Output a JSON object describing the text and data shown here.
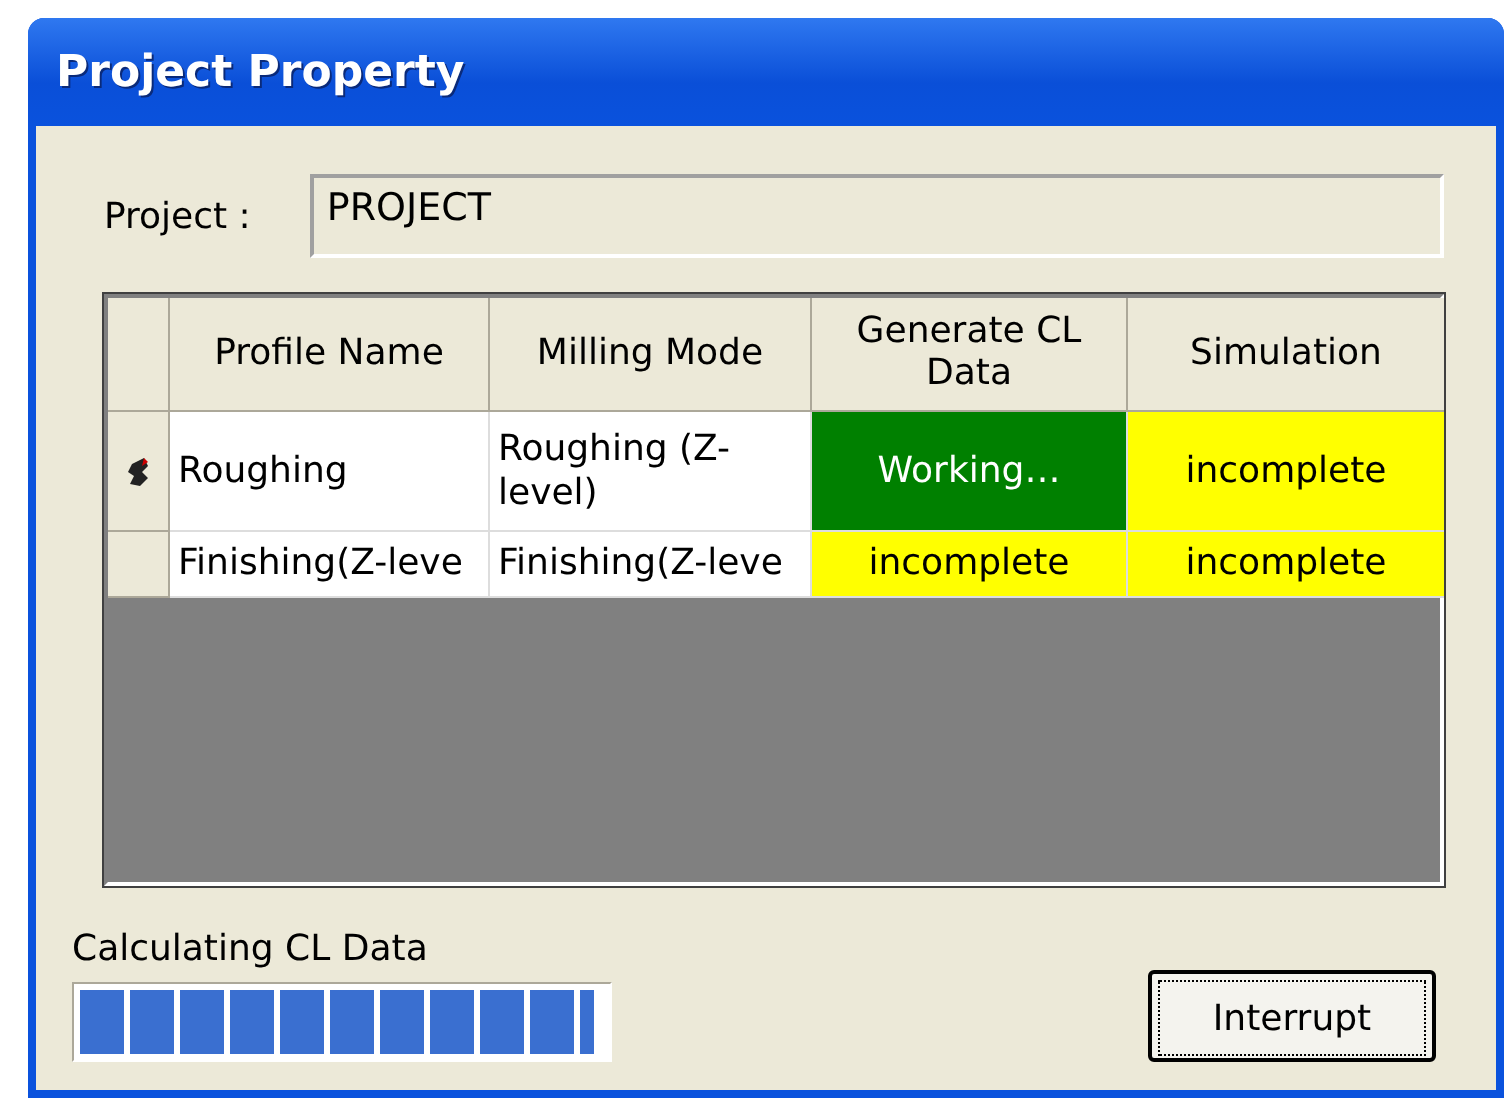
{
  "window": {
    "title": "Project Property"
  },
  "project": {
    "label": "Project :",
    "value": "PROJECT"
  },
  "table": {
    "columns": [
      "Profile Name",
      "Milling Mode",
      "Generate CL Data",
      "Simulation"
    ],
    "rows": [
      {
        "current": true,
        "cells": [
          {
            "text": "Roughing"
          },
          {
            "text": "Roughing (Z-level)"
          },
          {
            "text": "Working…",
            "color": "#008000"
          },
          {
            "text": "incomplete",
            "color": "#ffff00"
          }
        ]
      },
      {
        "current": false,
        "cells": [
          {
            "text": "Finishing(Z-leve"
          },
          {
            "text": "Finishing(Z-leve"
          },
          {
            "text": "incomplete",
            "color": "#ffff00"
          },
          {
            "text": "incomplete",
            "color": "#ffff00"
          }
        ]
      }
    ]
  },
  "progress": {
    "label": "Calculating CL Data",
    "level": 0.98
  },
  "buttons": [
    "Interrupt"
  ]
}
